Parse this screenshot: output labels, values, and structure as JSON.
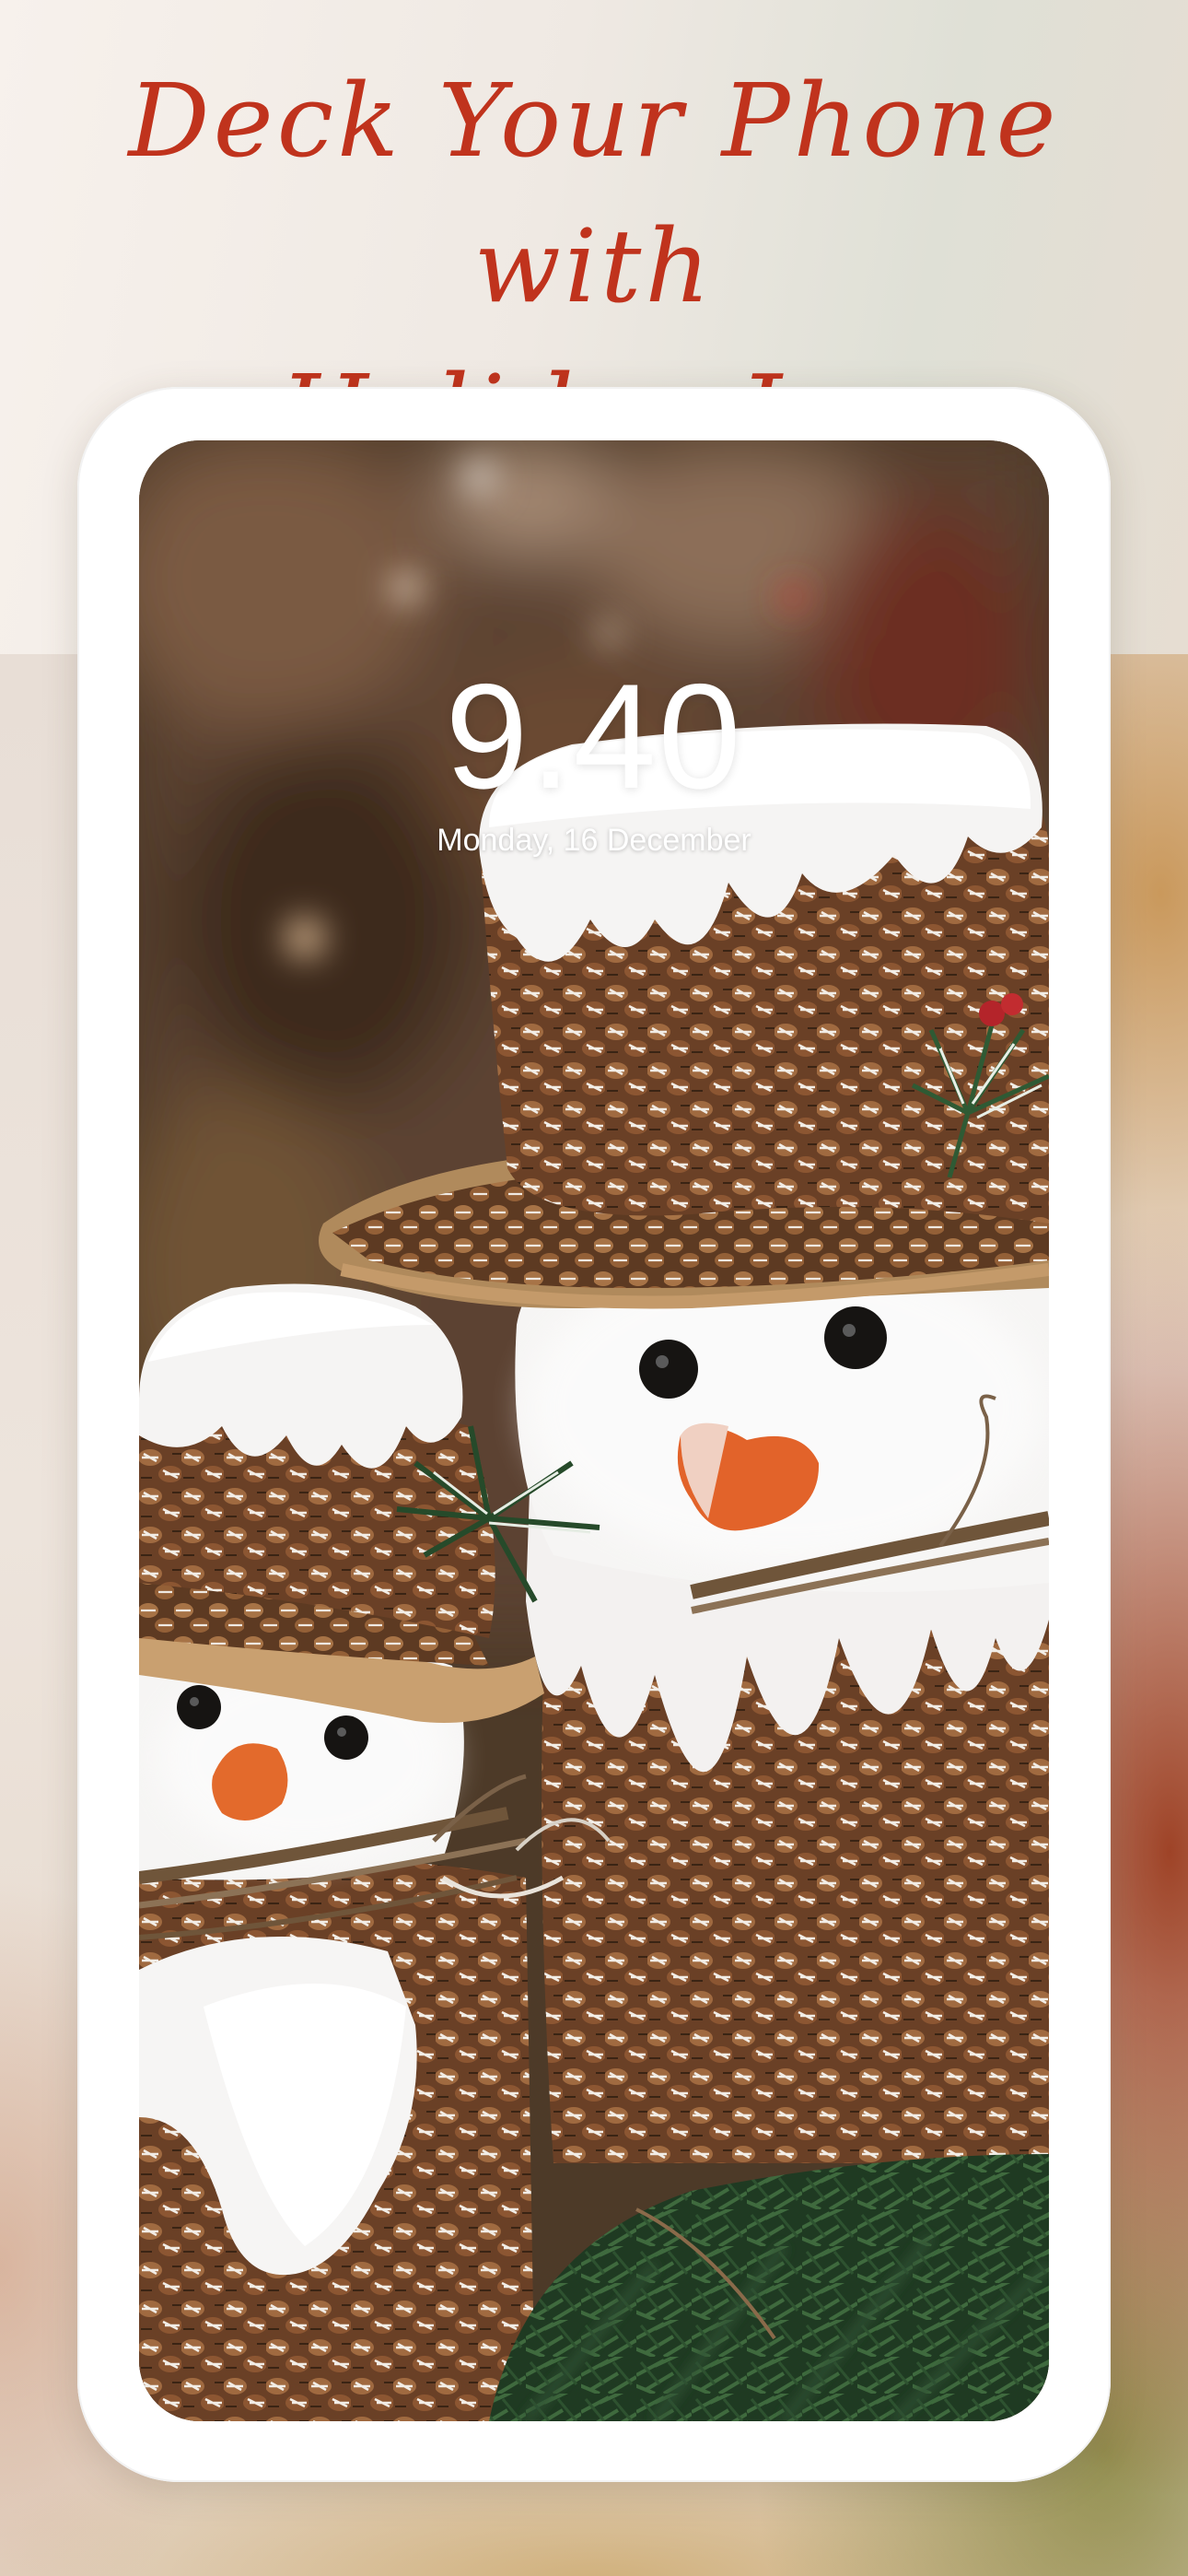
{
  "headline": {
    "line1": "Deck Your Phone with",
    "line2": "Holiday Joy"
  },
  "lock_screen": {
    "time": "9.40",
    "date": "Monday, 16 December"
  },
  "wallpaper": {
    "subject": "snowman-pinecone-decorations"
  },
  "colors": {
    "headline": "#c0331d",
    "phone_frame": "#ffffff",
    "lock_text": "#ffffff"
  }
}
